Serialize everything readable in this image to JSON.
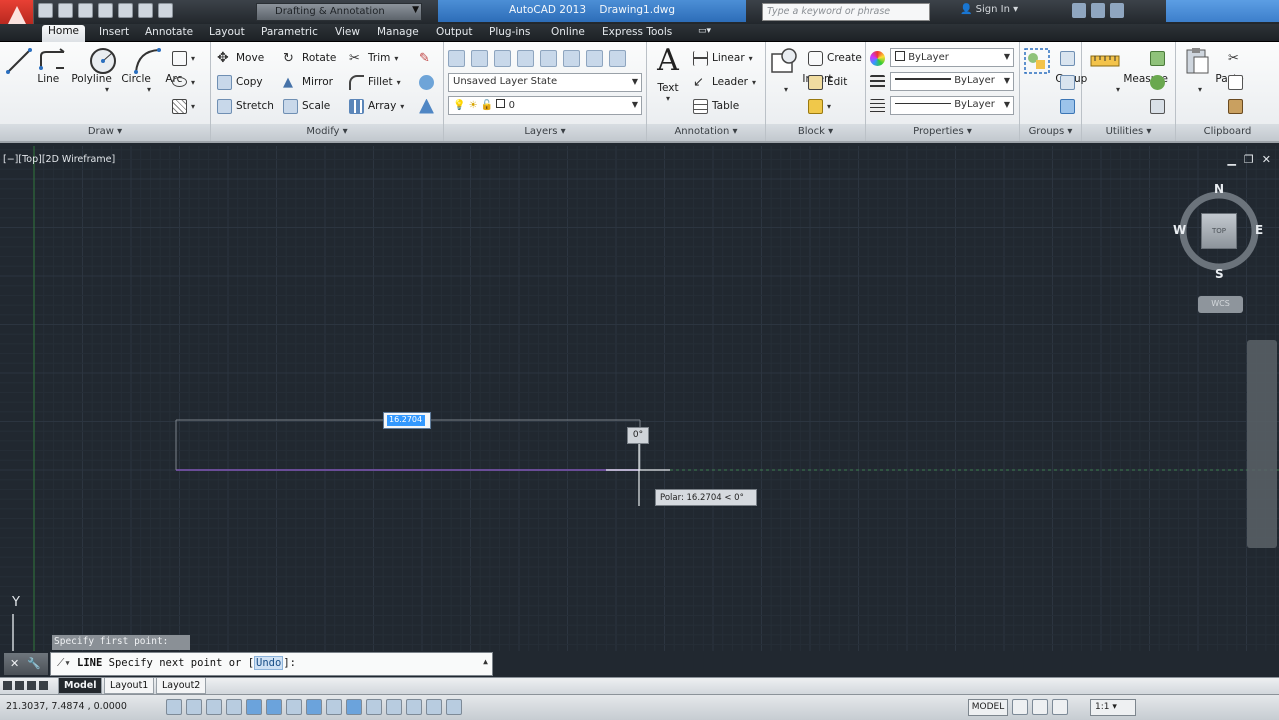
{
  "title_bar": {
    "app_title": "AutoCAD 2013",
    "document": "Drawing1.dwg",
    "workspace": "Drafting & Annotation",
    "search_placeholder": "Type a keyword or phrase",
    "sign_in": "Sign In"
  },
  "tabs": [
    "Home",
    "Insert",
    "Annotate",
    "Layout",
    "Parametric",
    "View",
    "Manage",
    "Output",
    "Plug-ins",
    "Online",
    "Express Tools"
  ],
  "active_tab": "Home",
  "ribbon": {
    "draw": {
      "title": "Draw",
      "line": "Line",
      "polyline": "Polyline",
      "circle": "Circle",
      "arc": "Arc"
    },
    "modify": {
      "title": "Modify",
      "move": "Move",
      "rotate": "Rotate",
      "trim": "Trim",
      "copy": "Copy",
      "mirror": "Mirror",
      "fillet": "Fillet",
      "stretch": "Stretch",
      "scale": "Scale",
      "array": "Array"
    },
    "layers": {
      "title": "Layers",
      "layer_state": "Unsaved Layer State",
      "current_layer": "0"
    },
    "annotation": {
      "title": "Annotation",
      "text": "Text",
      "linear": "Linear",
      "leader": "Leader",
      "table": "Table"
    },
    "block": {
      "title": "Block",
      "insert": "Insert",
      "create": "Create",
      "edit": "Edit"
    },
    "properties": {
      "title": "Properties",
      "color": "ByLayer",
      "linetype": "ByLayer",
      "lineweight": "ByLayer"
    },
    "groups": {
      "title": "Groups",
      "group": "Group"
    },
    "utilities": {
      "title": "Utilities",
      "measure": "Measure"
    },
    "clipboard": {
      "title": "Clipboard",
      "paste": "Paste"
    }
  },
  "viewport": {
    "label": "[−][Top][2D Wireframe]",
    "compass": {
      "n": "N",
      "s": "S",
      "e": "E",
      "w": "W",
      "face": "TOP"
    },
    "wcs": "WCS",
    "length_input": "16.2704",
    "angle_tooltip": "0°",
    "polar_tooltip": "Polar: 16.2704 < 0°",
    "y_axis_label": "Y",
    "prompt_history": "Specify first point:"
  },
  "command_line": {
    "command": "LINE",
    "prompt_before": " Specify next point or [",
    "option": "Undo",
    "prompt_after": "]:"
  },
  "layout_tabs": [
    "Model",
    "Layout1",
    "Layout2"
  ],
  "status_bar": {
    "coordinates": "21.3037, 7.4874 , 0.0000",
    "model": "MODEL",
    "annotation_scale": "1:1"
  },
  "colors": {
    "accent": "#3d7fcb",
    "canvas": "#212830",
    "app_red": "#d5281f"
  }
}
